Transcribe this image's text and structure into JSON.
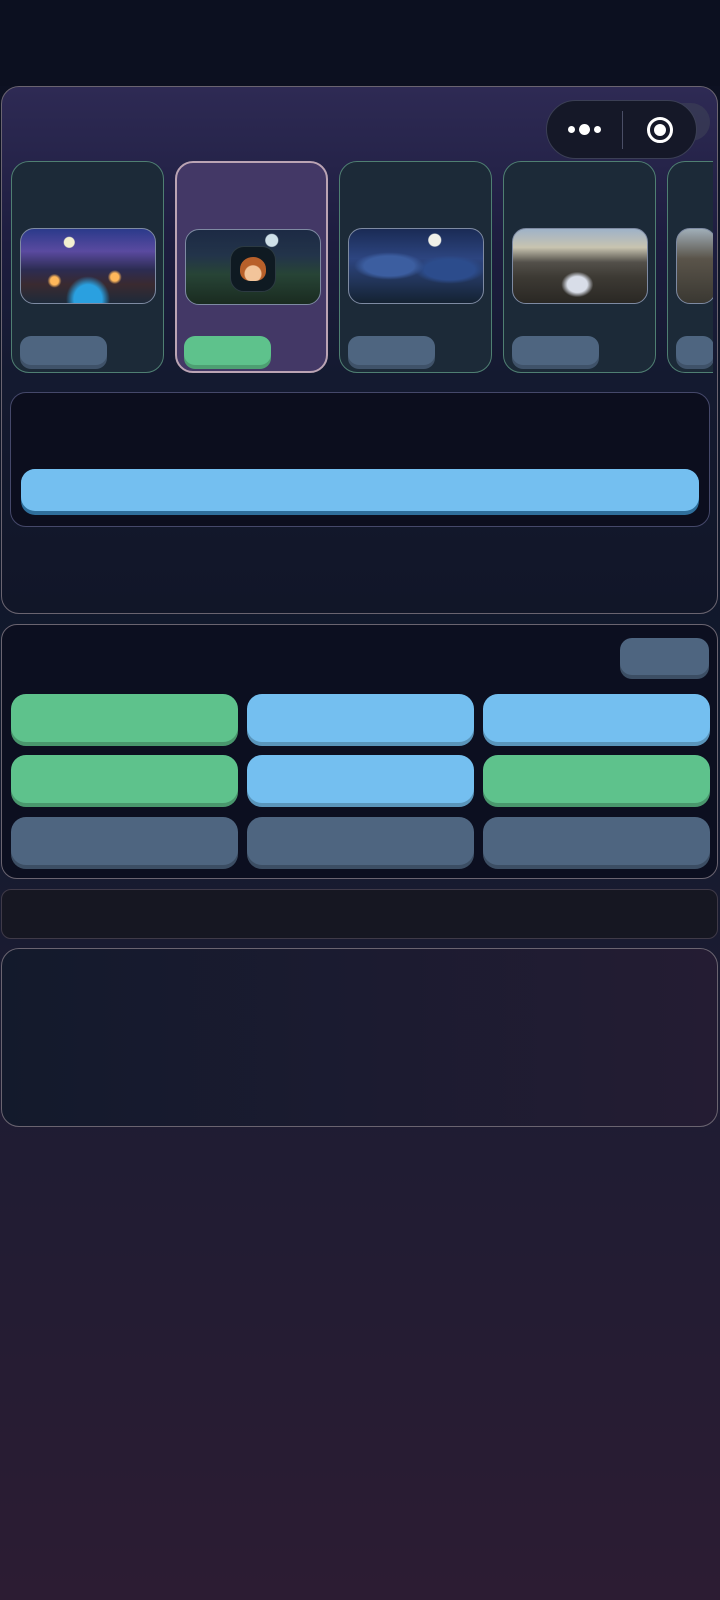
{
  "theme": {
    "accent_green": "#5ec28c",
    "accent_blue": "#74bff0",
    "neutral_slate": "#4e6580",
    "panel_dark": "#0c0f20"
  },
  "menu_capsule": {
    "more_icon": "more-dots-icon",
    "close_icon": "target-close-icon"
  },
  "scenes": [
    {
      "thumbnail": "night-village-riverside",
      "tag_color": "#4e6580",
      "selected": false
    },
    {
      "thumbnail": "moonlit-meadow-hero",
      "tag_color": "#5ec28c",
      "selected": true
    },
    {
      "thumbnail": "enchanted-blue-forest",
      "tag_color": "#4e6580",
      "selected": false
    },
    {
      "thumbnail": "stone-bridge-waterfall",
      "tag_color": "#4e6580",
      "selected": false
    },
    {
      "thumbnail": "mountain-pass",
      "tag_color": "#4e6580",
      "selected": false
    }
  ],
  "progress": {
    "fraction": 1.0
  },
  "actions": {
    "rows": [
      [
        "green",
        "blue",
        "blue"
      ],
      [
        "green",
        "blue",
        "green"
      ],
      [
        "slate",
        "slate",
        "slate"
      ]
    ]
  }
}
